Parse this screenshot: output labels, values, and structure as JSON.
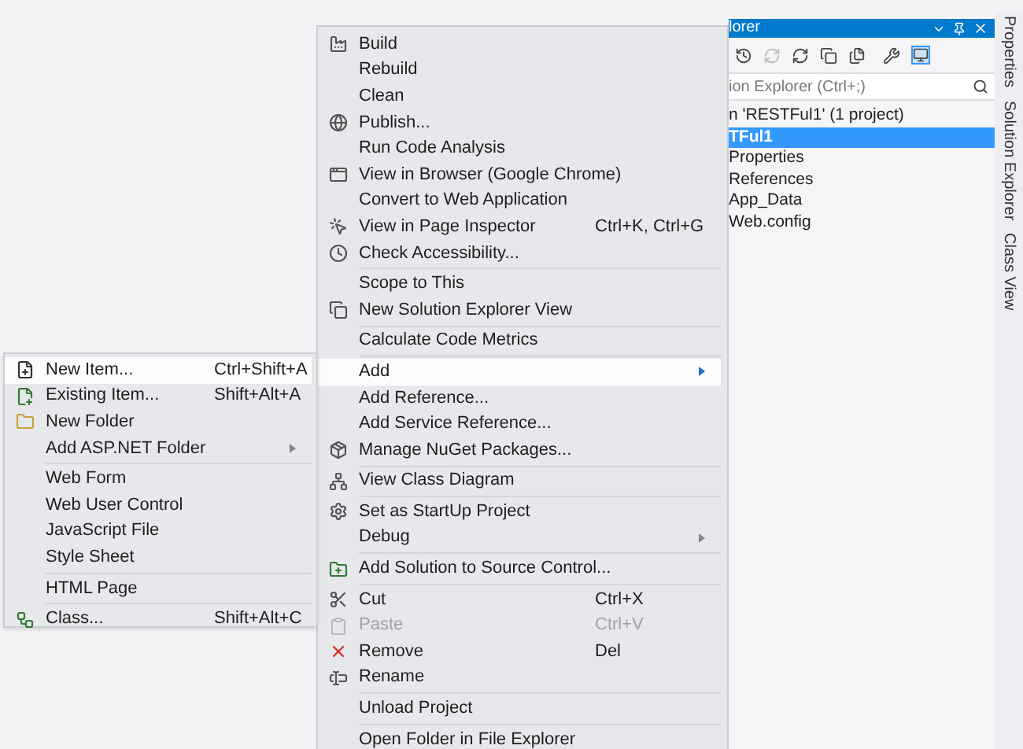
{
  "solution_explorer": {
    "title": "lorer",
    "search": {
      "placeholder": "ion Explorer (Ctrl+;)"
    },
    "tree": [
      {
        "label": "n 'RESTFul1' (1 project)",
        "selected": false
      },
      {
        "label": "TFul1",
        "selected": true
      },
      {
        "label": "Properties",
        "selected": false
      },
      {
        "label": "References",
        "selected": false
      },
      {
        "label": "App_Data",
        "selected": false
      },
      {
        "label": "Web.config",
        "selected": false
      }
    ]
  },
  "side_tabs": [
    "Properties",
    "Solution Explorer",
    "Class View"
  ],
  "context_menu": [
    {
      "kind": "item",
      "label": "Build",
      "selected": false,
      "disabled": false
    },
    {
      "kind": "item",
      "label": "Rebuild",
      "selected": false,
      "disabled": false
    },
    {
      "kind": "item",
      "label": "Clean",
      "selected": false,
      "disabled": false
    },
    {
      "kind": "item",
      "label": "Publish...",
      "selected": false,
      "disabled": false
    },
    {
      "kind": "item",
      "label": "Run Code Analysis",
      "selected": false,
      "disabled": false
    },
    {
      "kind": "item",
      "label": "View in Browser (Google Chrome)",
      "selected": false,
      "disabled": false
    },
    {
      "kind": "item",
      "label": "Convert to Web Application",
      "selected": false,
      "disabled": false
    },
    {
      "kind": "item",
      "label": "View in Page Inspector",
      "shortcut": "Ctrl+K, Ctrl+G",
      "selected": false,
      "disabled": false
    },
    {
      "kind": "item",
      "label": "Check Accessibility...",
      "selected": false,
      "disabled": false
    },
    {
      "kind": "separator"
    },
    {
      "kind": "item",
      "label": "Scope to This",
      "selected": false,
      "disabled": false
    },
    {
      "kind": "item",
      "label": "New Solution Explorer View",
      "selected": false,
      "disabled": false
    },
    {
      "kind": "separator"
    },
    {
      "kind": "item",
      "label": "Calculate Code Metrics",
      "selected": false,
      "disabled": false
    },
    {
      "kind": "separator"
    },
    {
      "kind": "submenu",
      "label": "Add",
      "selected": true,
      "disabled": false
    },
    {
      "kind": "item",
      "label": "Add Reference...",
      "selected": false,
      "disabled": false
    },
    {
      "kind": "item",
      "label": "Add Service Reference...",
      "selected": false,
      "disabled": false
    },
    {
      "kind": "item",
      "label": "Manage NuGet Packages...",
      "selected": false,
      "disabled": false
    },
    {
      "kind": "separator"
    },
    {
      "kind": "item",
      "label": "View Class Diagram",
      "selected": false,
      "disabled": false
    },
    {
      "kind": "separator"
    },
    {
      "kind": "item",
      "label": "Set as StartUp Project",
      "selected": false,
      "disabled": false
    },
    {
      "kind": "submenu",
      "label": "Debug",
      "selected": false,
      "disabled": false
    },
    {
      "kind": "separator"
    },
    {
      "kind": "item",
      "label": "Add Solution to Source Control...",
      "selected": false,
      "disabled": false
    },
    {
      "kind": "separator"
    },
    {
      "kind": "item",
      "label": "Cut",
      "shortcut": "Ctrl+X",
      "selected": false,
      "disabled": false
    },
    {
      "kind": "item",
      "label": "Paste",
      "shortcut": "Ctrl+V",
      "selected": false,
      "disabled": true
    },
    {
      "kind": "item",
      "label": "Remove",
      "shortcut": "Del",
      "selected": false,
      "disabled": false
    },
    {
      "kind": "item",
      "label": "Rename",
      "selected": false,
      "disabled": false
    },
    {
      "kind": "separator"
    },
    {
      "kind": "item",
      "label": "Unload Project",
      "selected": false,
      "disabled": false
    },
    {
      "kind": "separator"
    },
    {
      "kind": "item",
      "label": "Open Folder in File Explorer",
      "selected": false,
      "disabled": false
    }
  ],
  "add_submenu": [
    {
      "kind": "item",
      "label": "New Item...",
      "shortcut": "Ctrl+Shift+A",
      "selected": true,
      "disabled": false
    },
    {
      "kind": "item",
      "label": "Existing Item...",
      "shortcut": "Shift+Alt+A",
      "selected": false,
      "disabled": false
    },
    {
      "kind": "item",
      "label": "New Folder",
      "selected": false,
      "disabled": false
    },
    {
      "kind": "submenu",
      "label": "Add ASP.NET Folder",
      "selected": false,
      "disabled": false
    },
    {
      "kind": "separator"
    },
    {
      "kind": "item",
      "label": "Web Form",
      "selected": false,
      "disabled": false
    },
    {
      "kind": "item",
      "label": "Web User Control",
      "selected": false,
      "disabled": false
    },
    {
      "kind": "item",
      "label": "JavaScript File",
      "selected": false,
      "disabled": false
    },
    {
      "kind": "item",
      "label": "Style Sheet",
      "selected": false,
      "disabled": false
    },
    {
      "kind": "separator"
    },
    {
      "kind": "item",
      "label": "HTML Page",
      "selected": false,
      "disabled": false
    },
    {
      "kind": "separator"
    },
    {
      "kind": "item",
      "label": "Class...",
      "shortcut": "Shift+Alt+C",
      "selected": false,
      "disabled": false
    }
  ]
}
